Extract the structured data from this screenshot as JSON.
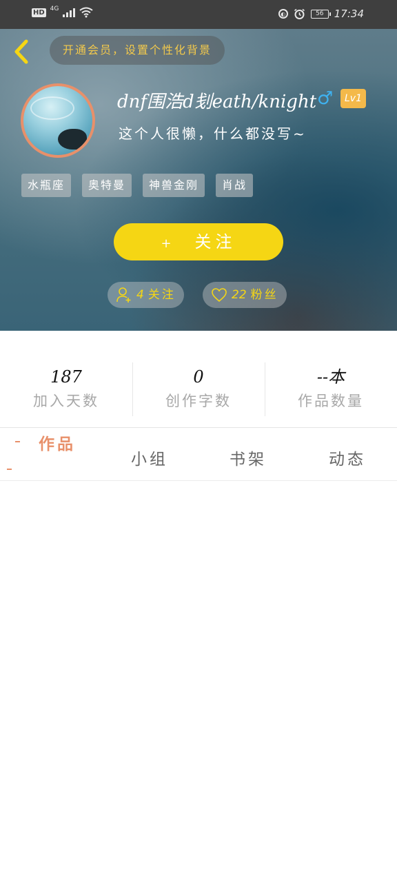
{
  "status_bar": {
    "hd": "HD",
    "network": "4G",
    "battery": "56",
    "time": "17:34"
  },
  "header": {
    "vip_prompt": "开通会员，设置个性化背景",
    "username": "dnf围浩d刬eath/knight",
    "gender_symbol": "♂",
    "level": "Lv1",
    "bio": "这个人很懒，什么都没写~",
    "tags": [
      "水瓶座",
      "奥特曼",
      "神兽金刚",
      "肖战"
    ],
    "follow_button": {
      "plus": "+",
      "label": "关注"
    },
    "following": {
      "count": "4",
      "label": "关注"
    },
    "fans": {
      "count": "22",
      "label": "粉丝"
    }
  },
  "counts": [
    {
      "value": "187",
      "label": "加入天数"
    },
    {
      "value": "0",
      "label": "创作字数"
    },
    {
      "value": "--本",
      "label": "作品数量"
    }
  ],
  "tabs": [
    "作品",
    "小组",
    "书架",
    "动态"
  ],
  "colors": {
    "accent_yellow": "#f5d614",
    "accent_orange": "#e8906a",
    "level_badge": "#f4b94a",
    "gender_blue": "#3fb2f0"
  }
}
